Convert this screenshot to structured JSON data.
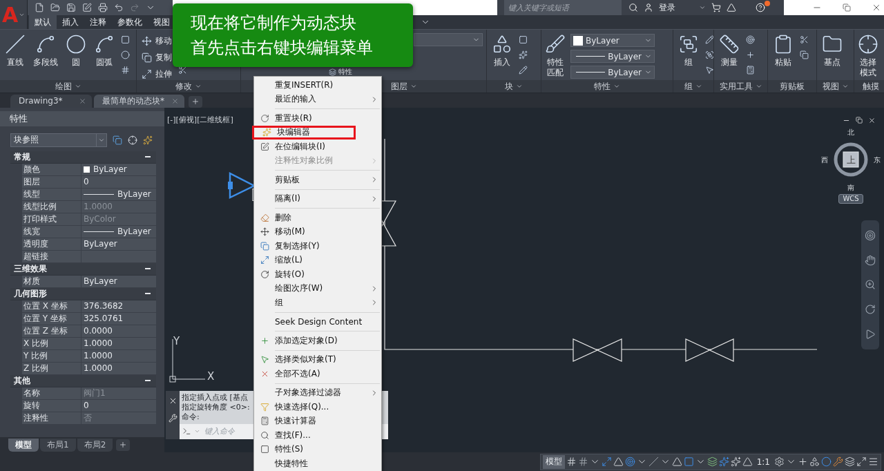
{
  "title_bar": {
    "app_logo": "A",
    "search": {
      "placeholder": "键入关键字或短语"
    },
    "user": "登录"
  },
  "ribbon": {
    "tabs": [
      {
        "label": "默认",
        "selected": true
      },
      {
        "label": "插入",
        "selected": false
      },
      {
        "label": "注释",
        "selected": false
      },
      {
        "label": "参数化",
        "selected": false
      },
      {
        "label": "视图",
        "selected": false
      }
    ],
    "panels": [
      {
        "title": "绘图",
        "menu": true,
        "tools": [
          {
            "kind": "large",
            "label": "直线"
          },
          {
            "kind": "large",
            "label": "多段线"
          },
          {
            "kind": "large",
            "label": "圆"
          },
          {
            "kind": "large",
            "label": "圆弧"
          }
        ]
      },
      {
        "title": "修改",
        "menu": true,
        "tools": [
          {
            "kind": "small",
            "label": "移动"
          },
          {
            "kind": "small",
            "label": "复制"
          },
          {
            "kind": "small",
            "label": "拉伸"
          }
        ]
      },
      {
        "title": "图层",
        "menu": true,
        "tools": [
          {
            "kind": "small",
            "label": "特性"
          },
          {
            "kind": "layer_combo"
          }
        ]
      },
      {
        "title": "块",
        "menu": true,
        "tools": [
          {
            "kind": "large",
            "label": "插入"
          }
        ]
      },
      {
        "title": "特性",
        "menu": true,
        "tools": [
          {
            "kind": "large",
            "label": "特性匹配"
          },
          {
            "kind": "swatch_combo",
            "label": "ByLayer"
          },
          {
            "kind": "line_combo",
            "label": "ByLayer"
          },
          {
            "kind": "line_combo",
            "label": "ByLayer"
          }
        ]
      },
      {
        "title": "组",
        "menu": true,
        "tools": [
          {
            "kind": "large",
            "label": "组"
          }
        ]
      },
      {
        "title": "实用工具",
        "menu": true,
        "tools": [
          {
            "kind": "large",
            "label": "测量"
          }
        ]
      },
      {
        "title": "剪贴板",
        "menu": false,
        "tools": [
          {
            "kind": "large",
            "label": "粘贴"
          }
        ]
      },
      {
        "title": "视图",
        "menu": true,
        "tools": [
          {
            "kind": "large",
            "label": "基点"
          }
        ]
      },
      {
        "title": "触摸",
        "menu": false,
        "tools": [
          {
            "kind": "large",
            "label": "选择模式"
          }
        ]
      }
    ]
  },
  "doc_tabs": [
    {
      "label": "Drawing3*",
      "selected": false
    },
    {
      "label": "最简单的动态块*",
      "selected": true
    }
  ],
  "properties": {
    "title": "特性",
    "selector": "块参照",
    "sections": [
      {
        "title": "常规",
        "expanded": true,
        "rows": [
          {
            "label": "颜色",
            "value": "ByLayer",
            "kind": "swatch",
            "disabled": false
          },
          {
            "label": "图层",
            "value": "0",
            "kind": "text",
            "disabled": false
          },
          {
            "label": "线型",
            "value": "ByLayer",
            "kind": "line",
            "disabled": false
          },
          {
            "label": "线型比例",
            "value": "1.0000",
            "kind": "text",
            "disabled": true
          },
          {
            "label": "打印样式",
            "value": "ByColor",
            "kind": "text",
            "disabled": true
          },
          {
            "label": "线宽",
            "value": "ByLayer",
            "kind": "line",
            "disabled": false
          },
          {
            "label": "透明度",
            "value": "ByLayer",
            "kind": "text",
            "disabled": false
          },
          {
            "label": "超链接",
            "kind": "text",
            "disabled": false
          }
        ]
      },
      {
        "title": "三维效果",
        "expanded": true,
        "rows": [
          {
            "label": "材质",
            "value": "ByLayer",
            "kind": "text",
            "disabled": false
          }
        ]
      },
      {
        "title": "几何图形",
        "expanded": true,
        "rows": [
          {
            "label": "位置 X 坐标",
            "value": "376.3682",
            "kind": "text",
            "disabled": false
          },
          {
            "label": "位置 Y 坐标",
            "value": "325.0761",
            "kind": "text",
            "disabled": false
          },
          {
            "label": "位置 Z 坐标",
            "value": "0.0000",
            "kind": "text",
            "disabled": false
          },
          {
            "label": "X 比例",
            "value": "1.0000",
            "kind": "text",
            "disabled": false
          },
          {
            "label": "Y 比例",
            "value": "1.0000",
            "kind": "text",
            "disabled": false
          },
          {
            "label": "Z 比例",
            "value": "1.0000",
            "kind": "text",
            "disabled": false
          }
        ]
      },
      {
        "title": "其他",
        "expanded": true,
        "rows": [
          {
            "label": "名称",
            "value": "阀门1",
            "kind": "text",
            "disabled": true
          },
          {
            "label": "旋转",
            "value": "0",
            "kind": "text",
            "disabled": false
          },
          {
            "label": "注释性",
            "value": "否",
            "kind": "text",
            "disabled": true
          }
        ]
      }
    ]
  },
  "layout_tabs": [
    {
      "label": "模型",
      "selected": true
    },
    {
      "label": "布局1",
      "selected": false
    },
    {
      "label": "布局2",
      "selected": false
    }
  ],
  "viewport": {
    "label": "[-][俯视][二维线框]",
    "compass": {
      "north": "北",
      "south": "南",
      "east": "东",
      "west": "西",
      "top": "上",
      "ucs": "WCS"
    }
  },
  "canvas": {
    "block": {
      "selected": true
    },
    "ucs_x": "X",
    "ucs_y": "Y"
  },
  "command_line": {
    "history": [
      "指定插入点或 [基点",
      "指定旋转角度 <0>:",
      "命令:"
    ],
    "placeholder": "键入命令"
  },
  "status_bar": {
    "model": "模型",
    "scale": "1:1"
  },
  "caption": {
    "lines": [
      "现在将它制作为动态块",
      "首先点击右键块编辑菜单"
    ]
  },
  "context_menu": {
    "groups": [
      [
        {
          "label": "重复INSERT(R)",
          "submenu": false,
          "disabled": false,
          "highlighted": false
        },
        {
          "label": "最近的输入",
          "submenu": true,
          "disabled": false,
          "highlighted": false
        }
      ],
      [
        {
          "label": "重置块(R)",
          "submenu": false,
          "disabled": false,
          "highlighted": false
        },
        {
          "label": "块编辑器",
          "submenu": false,
          "disabled": false,
          "highlighted": true
        },
        {
          "label": "在位编辑块(I)",
          "submenu": false,
          "disabled": false,
          "highlighted": false
        },
        {
          "label": "注释性对象比例",
          "submenu": true,
          "disabled": true,
          "highlighted": false
        }
      ],
      [
        {
          "label": "剪贴板",
          "submenu": true,
          "disabled": false,
          "highlighted": false
        }
      ],
      [
        {
          "label": "隔离(I)",
          "submenu": true,
          "disabled": false,
          "highlighted": false
        }
      ],
      [
        {
          "label": "删除",
          "submenu": false,
          "disabled": false,
          "highlighted": false
        },
        {
          "label": "移动(M)",
          "submenu": false,
          "disabled": false,
          "highlighted": false
        },
        {
          "label": "复制选择(Y)",
          "submenu": false,
          "disabled": false,
          "highlighted": false
        },
        {
          "label": "缩放(L)",
          "submenu": false,
          "disabled": false,
          "highlighted": false
        },
        {
          "label": "旋转(O)",
          "submenu": false,
          "disabled": false,
          "highlighted": false
        },
        {
          "label": "绘图次序(W)",
          "submenu": true,
          "disabled": false,
          "highlighted": false
        },
        {
          "label": "组",
          "submenu": true,
          "disabled": false,
          "highlighted": false
        }
      ],
      [
        {
          "label": "Seek Design Content",
          "submenu": false,
          "disabled": false,
          "highlighted": false
        }
      ],
      [
        {
          "label": "添加选定对象(D)",
          "submenu": false,
          "disabled": false,
          "highlighted": false
        }
      ],
      [
        {
          "label": "选择类似对象(T)",
          "submenu": false,
          "disabled": false,
          "highlighted": false
        },
        {
          "label": "全部不选(A)",
          "submenu": false,
          "disabled": false,
          "highlighted": false
        }
      ],
      [
        {
          "label": "子对象选择过滤器",
          "submenu": true,
          "disabled": false,
          "highlighted": false
        },
        {
          "label": "快速选择(Q)...",
          "submenu": false,
          "disabled": false,
          "highlighted": false
        },
        {
          "label": "快速计算器",
          "submenu": false,
          "disabled": false,
          "highlighted": false
        },
        {
          "label": "查找(F)...",
          "submenu": false,
          "disabled": false,
          "highlighted": false
        },
        {
          "label": "特性(S)",
          "submenu": false,
          "disabled": false,
          "highlighted": false
        },
        {
          "label": "快捷特性",
          "submenu": false,
          "disabled": false,
          "highlighted": false
        }
      ]
    ]
  }
}
